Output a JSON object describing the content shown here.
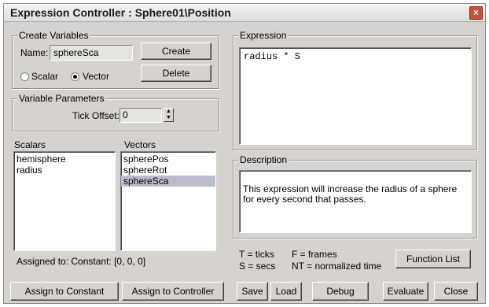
{
  "window": {
    "title": "Expression Controller : Sphere01\\Position",
    "close_glyph": "×"
  },
  "create_variables": {
    "legend": "Create Variables",
    "name_label": "Name:",
    "name_value": "sphereSca",
    "create_label": "Create",
    "delete_label": "Delete",
    "scalar_label": "Scalar",
    "vector_label": "Vector",
    "selected_type": "Vector"
  },
  "variable_parameters": {
    "legend": "Variable Parameters",
    "tick_offset_label": "Tick Offset:",
    "tick_offset_value": "0"
  },
  "scalars": {
    "label": "Scalars",
    "items": [
      "hemisphere",
      "radius"
    ]
  },
  "vectors": {
    "label": "Vectors",
    "items": [
      "spherePos",
      "sphereRot",
      "sphereSca"
    ],
    "selected_index": 2
  },
  "assigned_to": "Assigned to:  Constant: [0, 0, 0]",
  "expression": {
    "legend": "Expression",
    "text": "radius * S"
  },
  "description": {
    "legend": "Description",
    "text": "This expression will increase the radius of a sphere\nfor every second that passes."
  },
  "legend_help": {
    "t": "T = ticks",
    "s": "S = secs",
    "f": "F = frames",
    "nt": "NT = normalized time"
  },
  "buttons": {
    "function_list": "Function List",
    "assign_constant": "Assign to Constant",
    "assign_controller": "Assign to Controller",
    "save": "Save",
    "load": "Load",
    "debug": "Debug",
    "evaluate": "Evaluate",
    "close": "Close"
  },
  "icons": {
    "spin_up": "▲",
    "spin_down": "▼"
  }
}
